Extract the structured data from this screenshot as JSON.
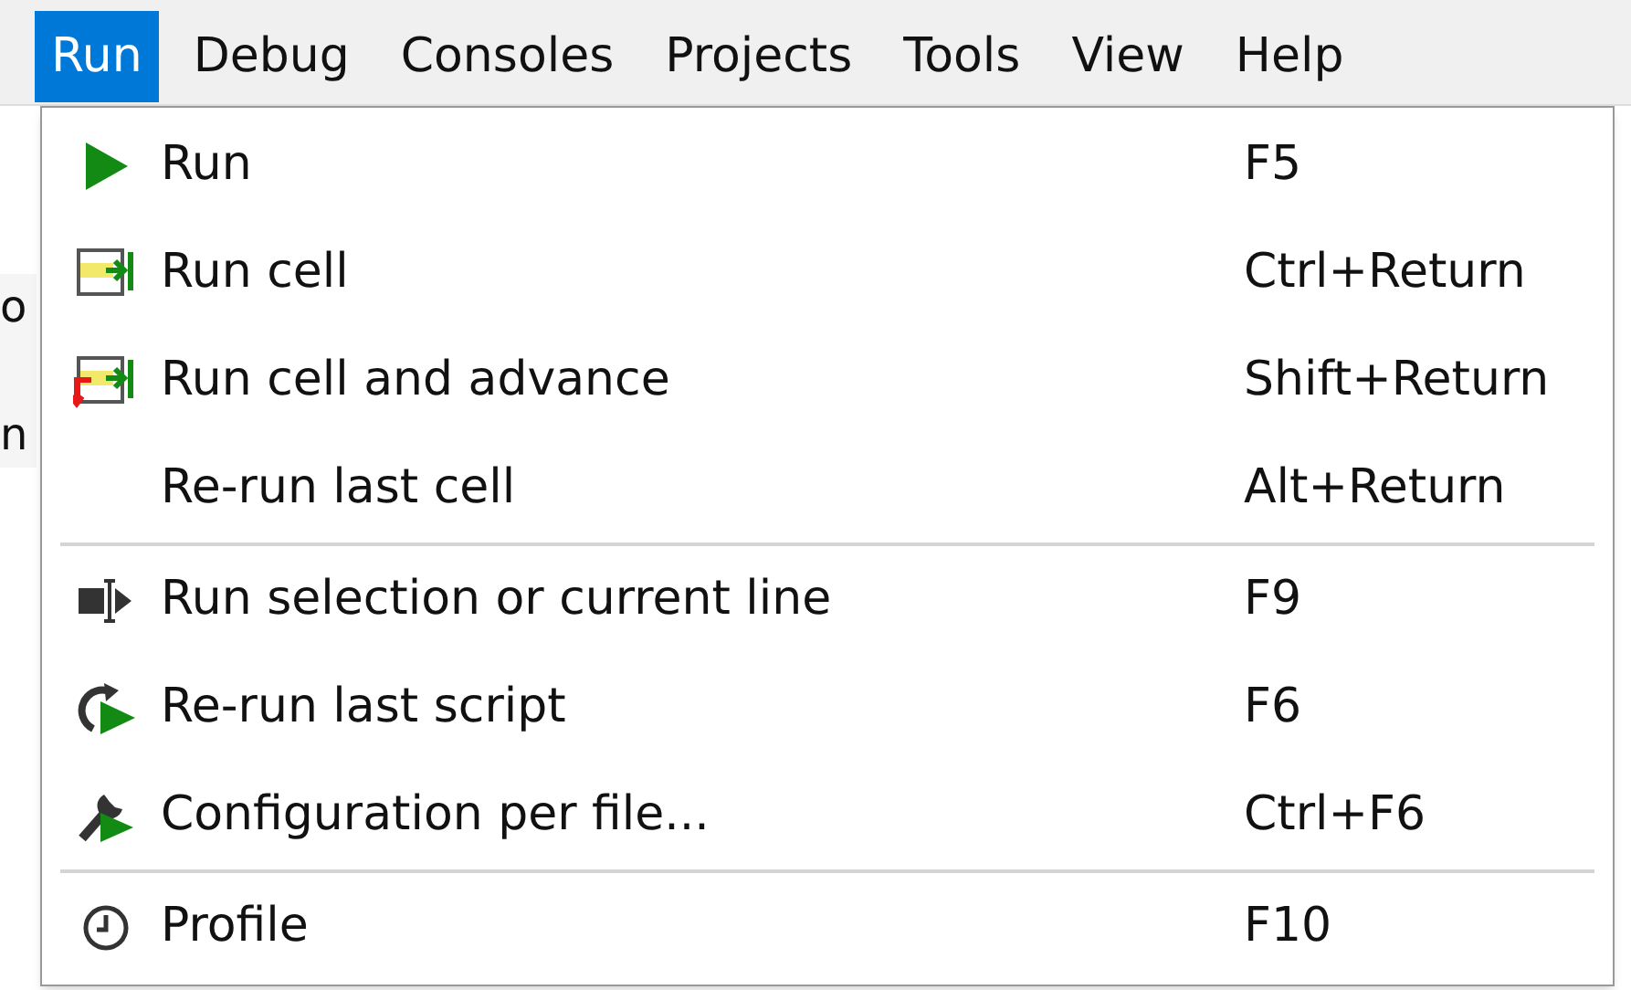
{
  "menubar": [
    {
      "label": "Run",
      "selected": true
    },
    {
      "label": "Debug",
      "selected": false
    },
    {
      "label": "Consoles",
      "selected": false
    },
    {
      "label": "Projects",
      "selected": false
    },
    {
      "label": "Tools",
      "selected": false
    },
    {
      "label": "View",
      "selected": false
    },
    {
      "label": "Help",
      "selected": false
    }
  ],
  "background_fragments": [
    "o",
    "n"
  ],
  "menu": {
    "sections": [
      [
        {
          "label": "Run",
          "shortcut": "F5"
        },
        {
          "label": "Run cell",
          "shortcut": "Ctrl+Return"
        },
        {
          "label": "Run cell and advance",
          "shortcut": "Shift+Return"
        },
        {
          "label": "Re-run last cell",
          "shortcut": "Alt+Return"
        }
      ],
      [
        {
          "label": "Run selection or current line",
          "shortcut": "F9"
        },
        {
          "label": "Re-run last script",
          "shortcut": "F6"
        },
        {
          "label": "Configuration per file...",
          "shortcut": "Ctrl+F6"
        }
      ],
      [
        {
          "label": "Profile",
          "shortcut": "F10"
        }
      ]
    ]
  }
}
